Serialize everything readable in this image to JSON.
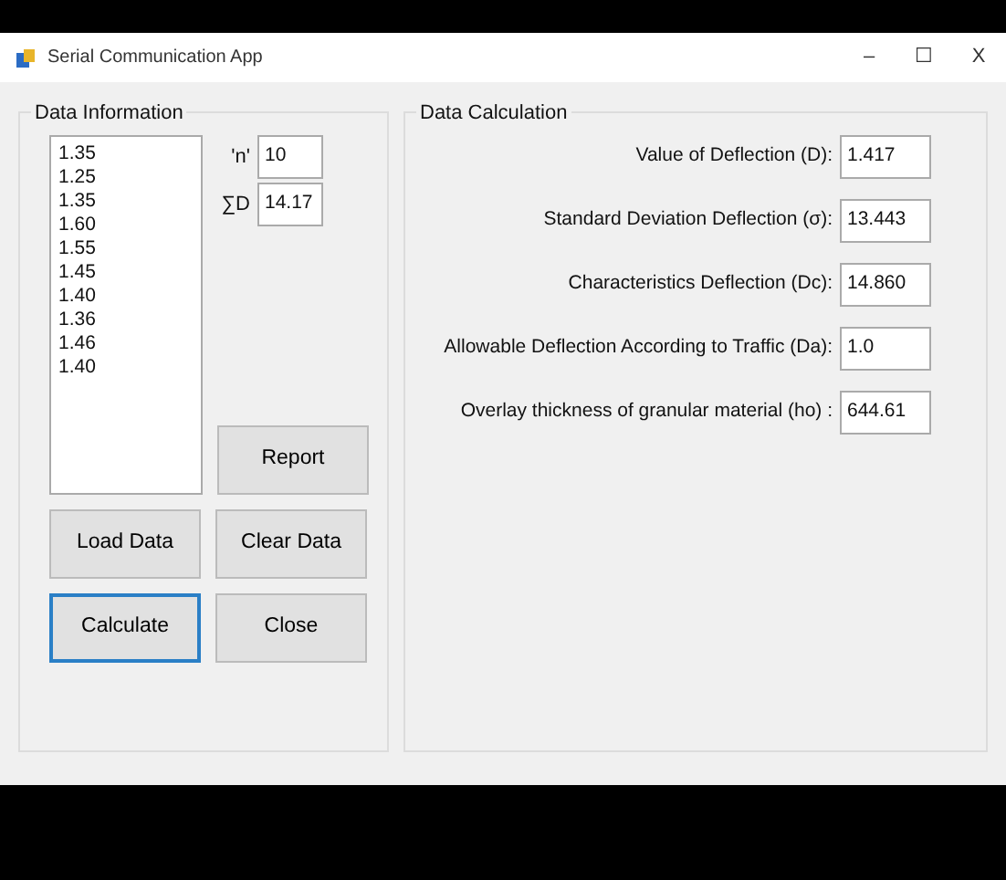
{
  "window": {
    "title": "Serial Communication App",
    "controls": [
      "–",
      "☐",
      "X"
    ]
  },
  "data_information": {
    "title": "Data Information",
    "values": [
      "1.35",
      "1.25",
      "1.35",
      "1.60",
      "1.55",
      "1.45",
      "1.40",
      "1.36",
      "1.46",
      "1.40"
    ],
    "fields": [
      {
        "label": "'n'",
        "value": "10"
      },
      {
        "label": "∑D",
        "value": "14.17"
      }
    ],
    "buttons": [
      {
        "label": "Report",
        "focused": false
      },
      {
        "label": "Load Data",
        "focused": false
      },
      {
        "label": "Clear Data",
        "focused": false
      },
      {
        "label": "Calculate",
        "focused": true
      },
      {
        "label": "Close",
        "focused": false
      }
    ]
  },
  "data_calculation": {
    "title": "Data Calculation",
    "rows": [
      {
        "label": "Value of Deflection (D):",
        "value": "1.417"
      },
      {
        "label": "Standard Deviation Deflection (σ):",
        "value": "13.443"
      },
      {
        "label": "Characteristics Deflection (Dc):",
        "value": "14.860"
      },
      {
        "label": "Allowable Deflection According to Traffic (Da):",
        "value": "1.0"
      },
      {
        "label": "Overlay thickness of granular material (ho) :",
        "value": "644.61"
      }
    ]
  }
}
